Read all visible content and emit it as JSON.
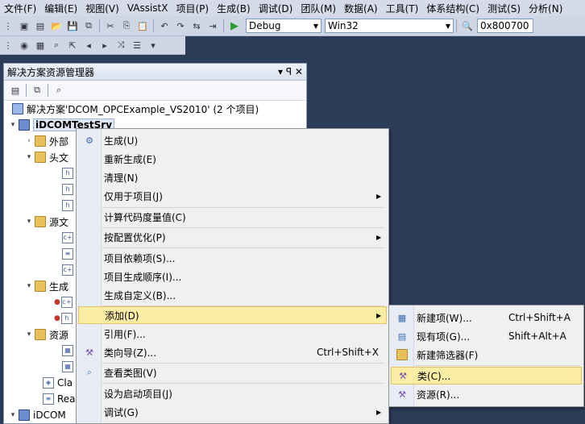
{
  "menubar": [
    "文件(F)",
    "编辑(E)",
    "视图(V)",
    "VAssistX",
    "项目(P)",
    "生成(B)",
    "调试(D)",
    "团队(M)",
    "数据(A)",
    "工具(T)",
    "体系结构(C)",
    "测试(S)",
    "分析(N)"
  ],
  "toolbar": {
    "config": "Debug",
    "platform": "Win32",
    "address": "0x800700"
  },
  "panel": {
    "title": "解决方案资源管理器",
    "pin": "▾ ꟼ ✕"
  },
  "tree": {
    "solution": "解决方案'DCOM_OPCExample_VS2010' (2 个项目)",
    "project": "iDCOMTestSrv",
    "items": [
      "外部",
      "头文",
      "源文",
      "生成",
      "资源",
      "Cla",
      "Rea"
    ],
    "project2": "iDCOM"
  },
  "context_menu": [
    {
      "label": "生成(U)",
      "icon": "build-icon"
    },
    {
      "label": "重新生成(E)"
    },
    {
      "label": "清理(N)"
    },
    {
      "label": "仅用于项目(J)",
      "submenu": true
    },
    {
      "label": "计算代码度量值(C)"
    },
    {
      "label": "按配置优化(P)",
      "submenu": true
    },
    {
      "label": "项目依赖项(S)..."
    },
    {
      "label": "项目生成顺序(I)..."
    },
    {
      "label": "生成自定义(B)..."
    },
    {
      "label": "添加(D)",
      "submenu": true,
      "highlight": true
    },
    {
      "label": "引用(F)..."
    },
    {
      "label": "类向导(Z)...",
      "shortcut": "Ctrl+Shift+X"
    },
    {
      "label": "查看类图(V)"
    },
    {
      "label": "设为启动项目(J)"
    },
    {
      "label": "调试(G)",
      "submenu": true
    }
  ],
  "sub_menu": [
    {
      "label": "新建项(W)...",
      "shortcut": "Ctrl+Shift+A"
    },
    {
      "label": "现有项(G)...",
      "shortcut": "Shift+Alt+A"
    },
    {
      "label": "新建筛选器(F)"
    },
    {
      "label": "类(C)...",
      "highlight": true
    },
    {
      "label": "资源(R)..."
    }
  ]
}
